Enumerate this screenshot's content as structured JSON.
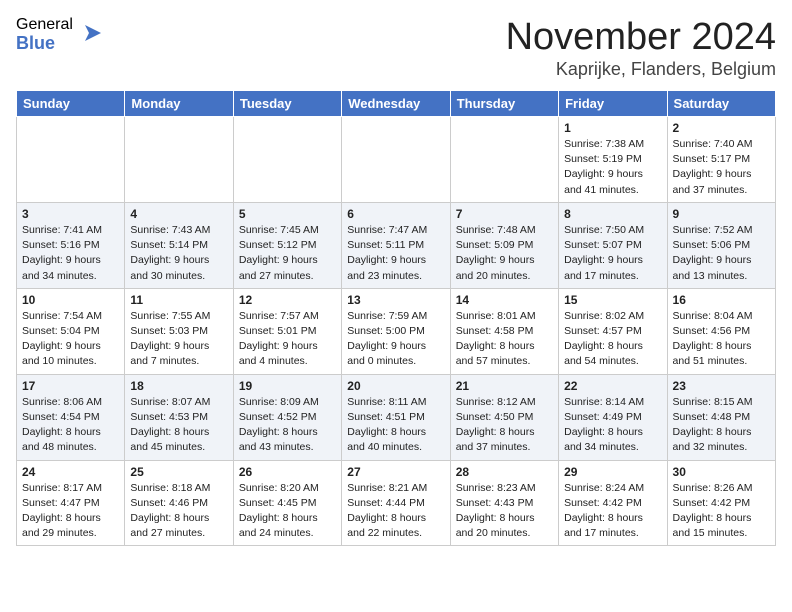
{
  "logo": {
    "general": "General",
    "blue": "Blue"
  },
  "title": "November 2024",
  "location": "Kaprijke, Flanders, Belgium",
  "days_of_week": [
    "Sunday",
    "Monday",
    "Tuesday",
    "Wednesday",
    "Thursday",
    "Friday",
    "Saturday"
  ],
  "weeks": [
    [
      {
        "day": "",
        "info": ""
      },
      {
        "day": "",
        "info": ""
      },
      {
        "day": "",
        "info": ""
      },
      {
        "day": "",
        "info": ""
      },
      {
        "day": "",
        "info": ""
      },
      {
        "day": "1",
        "info": "Sunrise: 7:38 AM\nSunset: 5:19 PM\nDaylight: 9 hours and 41 minutes."
      },
      {
        "day": "2",
        "info": "Sunrise: 7:40 AM\nSunset: 5:17 PM\nDaylight: 9 hours and 37 minutes."
      }
    ],
    [
      {
        "day": "3",
        "info": "Sunrise: 7:41 AM\nSunset: 5:16 PM\nDaylight: 9 hours and 34 minutes."
      },
      {
        "day": "4",
        "info": "Sunrise: 7:43 AM\nSunset: 5:14 PM\nDaylight: 9 hours and 30 minutes."
      },
      {
        "day": "5",
        "info": "Sunrise: 7:45 AM\nSunset: 5:12 PM\nDaylight: 9 hours and 27 minutes."
      },
      {
        "day": "6",
        "info": "Sunrise: 7:47 AM\nSunset: 5:11 PM\nDaylight: 9 hours and 23 minutes."
      },
      {
        "day": "7",
        "info": "Sunrise: 7:48 AM\nSunset: 5:09 PM\nDaylight: 9 hours and 20 minutes."
      },
      {
        "day": "8",
        "info": "Sunrise: 7:50 AM\nSunset: 5:07 PM\nDaylight: 9 hours and 17 minutes."
      },
      {
        "day": "9",
        "info": "Sunrise: 7:52 AM\nSunset: 5:06 PM\nDaylight: 9 hours and 13 minutes."
      }
    ],
    [
      {
        "day": "10",
        "info": "Sunrise: 7:54 AM\nSunset: 5:04 PM\nDaylight: 9 hours and 10 minutes."
      },
      {
        "day": "11",
        "info": "Sunrise: 7:55 AM\nSunset: 5:03 PM\nDaylight: 9 hours and 7 minutes."
      },
      {
        "day": "12",
        "info": "Sunrise: 7:57 AM\nSunset: 5:01 PM\nDaylight: 9 hours and 4 minutes."
      },
      {
        "day": "13",
        "info": "Sunrise: 7:59 AM\nSunset: 5:00 PM\nDaylight: 9 hours and 0 minutes."
      },
      {
        "day": "14",
        "info": "Sunrise: 8:01 AM\nSunset: 4:58 PM\nDaylight: 8 hours and 57 minutes."
      },
      {
        "day": "15",
        "info": "Sunrise: 8:02 AM\nSunset: 4:57 PM\nDaylight: 8 hours and 54 minutes."
      },
      {
        "day": "16",
        "info": "Sunrise: 8:04 AM\nSunset: 4:56 PM\nDaylight: 8 hours and 51 minutes."
      }
    ],
    [
      {
        "day": "17",
        "info": "Sunrise: 8:06 AM\nSunset: 4:54 PM\nDaylight: 8 hours and 48 minutes."
      },
      {
        "day": "18",
        "info": "Sunrise: 8:07 AM\nSunset: 4:53 PM\nDaylight: 8 hours and 45 minutes."
      },
      {
        "day": "19",
        "info": "Sunrise: 8:09 AM\nSunset: 4:52 PM\nDaylight: 8 hours and 43 minutes."
      },
      {
        "day": "20",
        "info": "Sunrise: 8:11 AM\nSunset: 4:51 PM\nDaylight: 8 hours and 40 minutes."
      },
      {
        "day": "21",
        "info": "Sunrise: 8:12 AM\nSunset: 4:50 PM\nDaylight: 8 hours and 37 minutes."
      },
      {
        "day": "22",
        "info": "Sunrise: 8:14 AM\nSunset: 4:49 PM\nDaylight: 8 hours and 34 minutes."
      },
      {
        "day": "23",
        "info": "Sunrise: 8:15 AM\nSunset: 4:48 PM\nDaylight: 8 hours and 32 minutes."
      }
    ],
    [
      {
        "day": "24",
        "info": "Sunrise: 8:17 AM\nSunset: 4:47 PM\nDaylight: 8 hours and 29 minutes."
      },
      {
        "day": "25",
        "info": "Sunrise: 8:18 AM\nSunset: 4:46 PM\nDaylight: 8 hours and 27 minutes."
      },
      {
        "day": "26",
        "info": "Sunrise: 8:20 AM\nSunset: 4:45 PM\nDaylight: 8 hours and 24 minutes."
      },
      {
        "day": "27",
        "info": "Sunrise: 8:21 AM\nSunset: 4:44 PM\nDaylight: 8 hours and 22 minutes."
      },
      {
        "day": "28",
        "info": "Sunrise: 8:23 AM\nSunset: 4:43 PM\nDaylight: 8 hours and 20 minutes."
      },
      {
        "day": "29",
        "info": "Sunrise: 8:24 AM\nSunset: 4:42 PM\nDaylight: 8 hours and 17 minutes."
      },
      {
        "day": "30",
        "info": "Sunrise: 8:26 AM\nSunset: 4:42 PM\nDaylight: 8 hours and 15 minutes."
      }
    ]
  ]
}
